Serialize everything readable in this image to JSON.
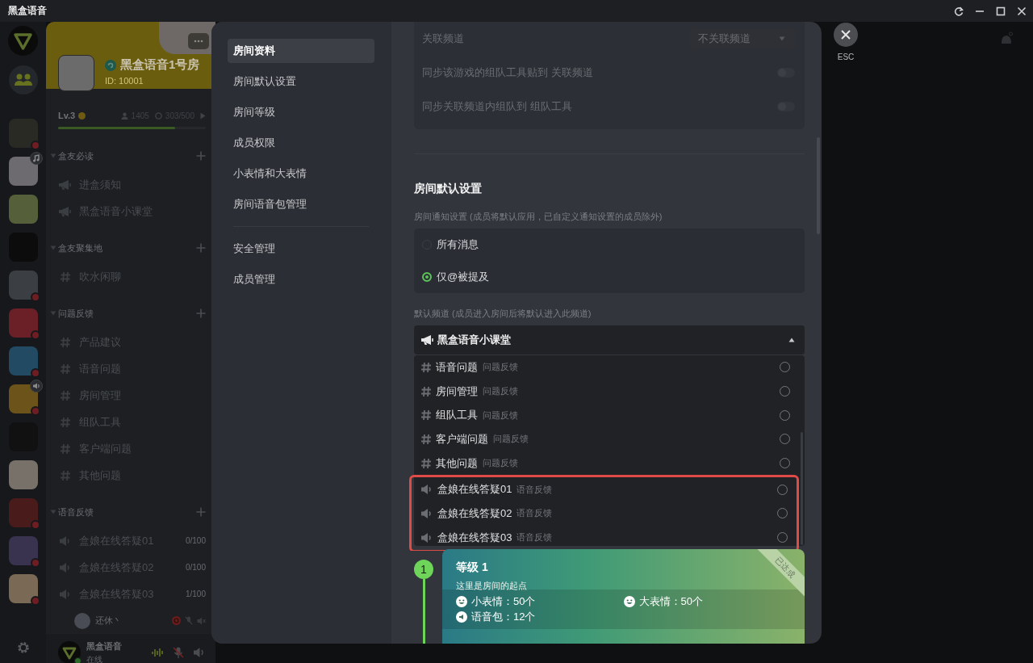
{
  "window": {
    "title": "黑盒语音"
  },
  "rail": {
    "items": [
      {
        "kind": "logo",
        "alert": false,
        "music": false,
        "voice": false
      },
      {
        "kind": "friends",
        "alert": false,
        "music": false,
        "voice": false
      },
      {
        "kind": "game",
        "alert": true,
        "music": false,
        "voice": false
      },
      {
        "kind": "game",
        "alert": false,
        "music": true,
        "voice": false
      },
      {
        "kind": "game",
        "alert": false,
        "music": false,
        "voice": false
      },
      {
        "kind": "game",
        "alert": false,
        "music": false,
        "voice": false
      },
      {
        "kind": "game",
        "alert": true,
        "music": false,
        "voice": false
      },
      {
        "kind": "game",
        "alert": true,
        "music": false,
        "voice": false
      },
      {
        "kind": "game",
        "alert": true,
        "music": false,
        "voice": false
      },
      {
        "kind": "game",
        "alert": true,
        "music": false,
        "voice": true
      },
      {
        "kind": "game",
        "alert": false,
        "music": false,
        "voice": false
      },
      {
        "kind": "game",
        "alert": false,
        "music": false,
        "voice": false
      },
      {
        "kind": "game",
        "alert": true,
        "music": false,
        "voice": false
      },
      {
        "kind": "game",
        "alert": true,
        "music": false,
        "voice": false
      },
      {
        "kind": "game",
        "alert": true,
        "music": false,
        "voice": false
      }
    ]
  },
  "room": {
    "name": "黑盒语音1号房",
    "id": "ID: 10001",
    "rank": "Lv.3",
    "members": "1405",
    "online": "303/500",
    "progress_bar": {
      "level": 0.79
    }
  },
  "categories": [
    {
      "name": "盒友必读",
      "expanded": true,
      "channels": [
        {
          "kind": "announce",
          "name": "进盒须知"
        },
        {
          "kind": "announce",
          "name": "黑盒语音小课堂"
        }
      ]
    },
    {
      "name": "盒友聚集地",
      "expanded": true,
      "channels": [
        {
          "kind": "text",
          "name": "吹水闲聊"
        }
      ]
    },
    {
      "name": "问题反馈",
      "expanded": true,
      "channels": [
        {
          "kind": "text",
          "name": "产品建议"
        },
        {
          "kind": "text",
          "name": "语音问题"
        },
        {
          "kind": "text",
          "name": "房间管理"
        },
        {
          "kind": "text",
          "name": "组队工具"
        },
        {
          "kind": "text",
          "name": "客户端问题"
        },
        {
          "kind": "text",
          "name": "其他问题"
        }
      ]
    },
    {
      "name": "语音反馈",
      "expanded": true,
      "channels": [
        {
          "kind": "voice",
          "name": "盒娘在线答疑01",
          "count": "0/100"
        },
        {
          "kind": "voice",
          "name": "盒娘在线答疑02",
          "count": "0/100"
        },
        {
          "kind": "voice",
          "name": "盒娘在线答疑03",
          "count": "1/100",
          "members": [
            {
              "name": "还休丶",
              "live": true,
              "mic_muted": true,
              "deafened": true
            }
          ]
        }
      ]
    }
  ],
  "user": {
    "name": "黑盒语音",
    "status": "在线",
    "online": true,
    "mic_muted": true
  },
  "settings_nav": {
    "groups": [
      {
        "items": [
          {
            "label": "房间资料",
            "selected": true
          },
          {
            "label": "房间默认设置",
            "selected": false
          },
          {
            "label": "房间等级",
            "selected": false
          },
          {
            "label": "成员权限",
            "selected": false
          },
          {
            "label": "小表情和大表情",
            "selected": false
          },
          {
            "label": "房间语音包管理",
            "selected": false
          }
        ]
      },
      {
        "items": [
          {
            "label": "安全管理",
            "selected": false
          },
          {
            "label": "成员管理",
            "selected": false
          }
        ]
      }
    ]
  },
  "link_settings": {
    "rows": [
      {
        "kind": "select",
        "label": "关联频道",
        "value": "不关联频道"
      },
      {
        "kind": "toggle",
        "label": "同步该游戏的组队工具贴到 关联频道",
        "on": false
      },
      {
        "kind": "toggle",
        "label": "同步关联频道内组队到 组队工具",
        "on": false
      }
    ]
  },
  "default_settings": {
    "heading": "房间默认设置",
    "notify_label": "房间通知设置 (成员将默认应用，已自定义通知设置的成员除外)",
    "notify_options": [
      {
        "label": "所有消息",
        "selected": false
      },
      {
        "label": "仅@被提及",
        "selected": true
      }
    ],
    "channel_label": "默认频道 (成员进入房间后将默认进入此频道)",
    "channel_select": {
      "value": "黑盒语音小课堂",
      "expanded": true
    },
    "channel_options": [
      {
        "kind": "text",
        "name": "语音问题",
        "group": "问题反馈",
        "selected": false,
        "highlighted": false
      },
      {
        "kind": "text",
        "name": "房间管理",
        "group": "问题反馈",
        "selected": false,
        "highlighted": false
      },
      {
        "kind": "text",
        "name": "组队工具",
        "group": "问题反馈",
        "selected": false,
        "highlighted": false
      },
      {
        "kind": "text",
        "name": "客户端问题",
        "group": "问题反馈",
        "selected": false,
        "highlighted": false
      },
      {
        "kind": "text",
        "name": "其他问题",
        "group": "问题反馈",
        "selected": false,
        "highlighted": false
      },
      {
        "kind": "voice",
        "name": "盒娘在线答疑01",
        "group": "语音反馈",
        "selected": false,
        "highlighted": true
      },
      {
        "kind": "voice",
        "name": "盒娘在线答疑02",
        "group": "语音反馈",
        "selected": false,
        "highlighted": true
      },
      {
        "kind": "voice",
        "name": "盒娘在线答疑03",
        "group": "语音反馈",
        "selected": false,
        "highlighted": true
      }
    ]
  },
  "levels": [
    {
      "number": "1",
      "title": "等级 1",
      "subtitle": "这里是房间的起点",
      "ribbon": "已达成",
      "reached": true,
      "perks": [
        {
          "kind": "emoji",
          "text": "小表情：50个"
        },
        {
          "kind": "emoji",
          "text": "大表情：50个"
        },
        {
          "kind": "voice",
          "text": "语音包：12个"
        }
      ]
    }
  ],
  "close": {
    "label": "ESC"
  }
}
